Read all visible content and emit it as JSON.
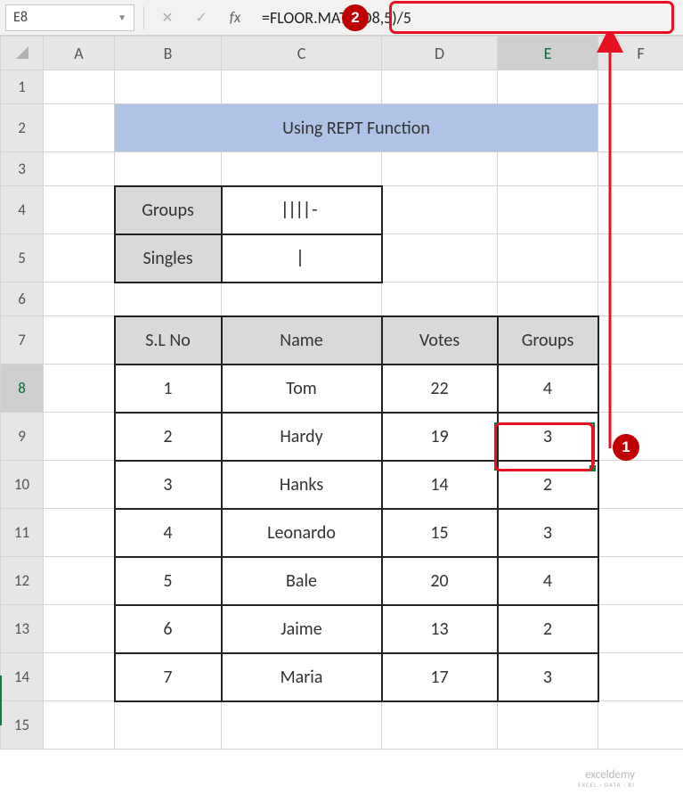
{
  "name_box": "E8",
  "fx_label": "fx",
  "formula": "=FLOOR.MATH(D8,5)/5",
  "columns": [
    "A",
    "B",
    "C",
    "D",
    "E",
    "F"
  ],
  "row_numbers": [
    "1",
    "2",
    "3",
    "4",
    "5",
    "6",
    "7",
    "8",
    "9",
    "10",
    "11",
    "12",
    "13",
    "14",
    "15"
  ],
  "title": "Using REPT Function",
  "small_table": {
    "rows": [
      {
        "label": "Groups",
        "value": "||||-"
      },
      {
        "label": "Singles",
        "value": "|"
      }
    ]
  },
  "table_header": [
    "S.L No",
    "Name",
    "Votes",
    "Groups"
  ],
  "table_rows": [
    {
      "sl": "1",
      "name": "Tom",
      "votes": "22",
      "groups": "4"
    },
    {
      "sl": "2",
      "name": "Hardy",
      "votes": "19",
      "groups": "3"
    },
    {
      "sl": "3",
      "name": "Hanks",
      "votes": "14",
      "groups": "2"
    },
    {
      "sl": "4",
      "name": "Leonardo",
      "votes": "15",
      "groups": "3"
    },
    {
      "sl": "5",
      "name": "Bale",
      "votes": "20",
      "groups": "4"
    },
    {
      "sl": "6",
      "name": "Jaime",
      "votes": "13",
      "groups": "2"
    },
    {
      "sl": "7",
      "name": "Maria",
      "votes": "17",
      "groups": "3"
    }
  ],
  "badges": {
    "b1": "1",
    "b2": "2"
  },
  "watermark": {
    "main": "exceldemy",
    "sub": "EXCEL · DATA · BI"
  }
}
